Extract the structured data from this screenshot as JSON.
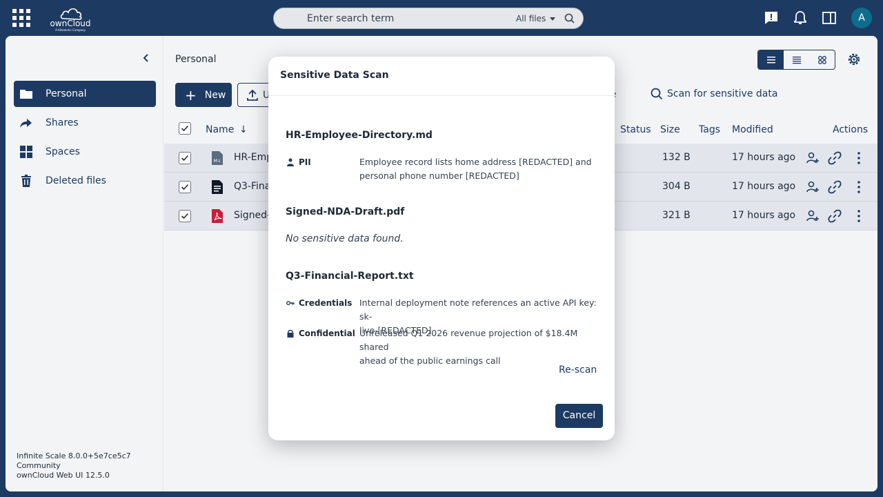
{
  "topbar": {
    "logo_text": "ownCloud",
    "logo_tagline": "A Kiteworks Company",
    "search_placeholder": "Enter search term",
    "search_scope": "All files",
    "avatar_initial": "A"
  },
  "sidebar": {
    "items": [
      {
        "label": "Personal",
        "icon": "folder-icon",
        "active": true
      },
      {
        "label": "Shares",
        "icon": "share-icon",
        "active": false
      },
      {
        "label": "Spaces",
        "icon": "spaces-icon",
        "active": false
      },
      {
        "label": "Deleted files",
        "icon": "trash-icon",
        "active": false
      }
    ],
    "version_lines": [
      "Infinite Scale 8.0.0+5e7ce5c7",
      "Community",
      "ownCloud Web UI 12.5.0"
    ]
  },
  "main": {
    "breadcrumb": "Personal",
    "new_label": "New",
    "upload_label": "U",
    "delete_label": "elete",
    "scan_label": "Scan for sensitive data",
    "columns": {
      "name": "Name",
      "status": "Status",
      "size": "Size",
      "tags": "Tags",
      "modified": "Modified",
      "actions": "Actions"
    },
    "rows": [
      {
        "name": "HR-Emp",
        "size": "132 B",
        "modified": "17 hours ago",
        "type": "markdown"
      },
      {
        "name": "Q3-Fina",
        "size": "304 B",
        "modified": "17 hours ago",
        "type": "text"
      },
      {
        "name": "Signed-",
        "size": "321 B",
        "modified": "17 hours ago",
        "type": "pdf"
      }
    ]
  },
  "modal": {
    "title": "Sensitive Data Scan",
    "files": [
      {
        "name": "HR-Employee-Directory.md",
        "findings": [
          {
            "label": "PII",
            "icon": "person-icon",
            "lines": [
              "Employee record lists home address [REDACTED] and",
              "personal phone number [REDACTED]"
            ]
          }
        ]
      },
      {
        "name": "Signed-NDA-Draft.pdf",
        "none_text": "No sensitive data found."
      },
      {
        "name": "Q3-Financial-Report.txt",
        "findings": [
          {
            "label": "Credentials",
            "icon": "key-icon",
            "lines": [
              "Internal deployment note references an active API key: sk-",
              "live-[REDACTED]"
            ]
          },
          {
            "label": "Confidential",
            "icon": "lock-icon",
            "lines": [
              "Unreleased Q1 2026 revenue projection of $18.4M shared",
              "ahead of the public earnings call"
            ]
          }
        ]
      }
    ],
    "rescan_label": "Re-scan",
    "cancel_label": "Cancel"
  },
  "colors": {
    "brand": "#1d3a63",
    "pdf": "#c81e3c",
    "avatar": "#0e6d8c"
  }
}
